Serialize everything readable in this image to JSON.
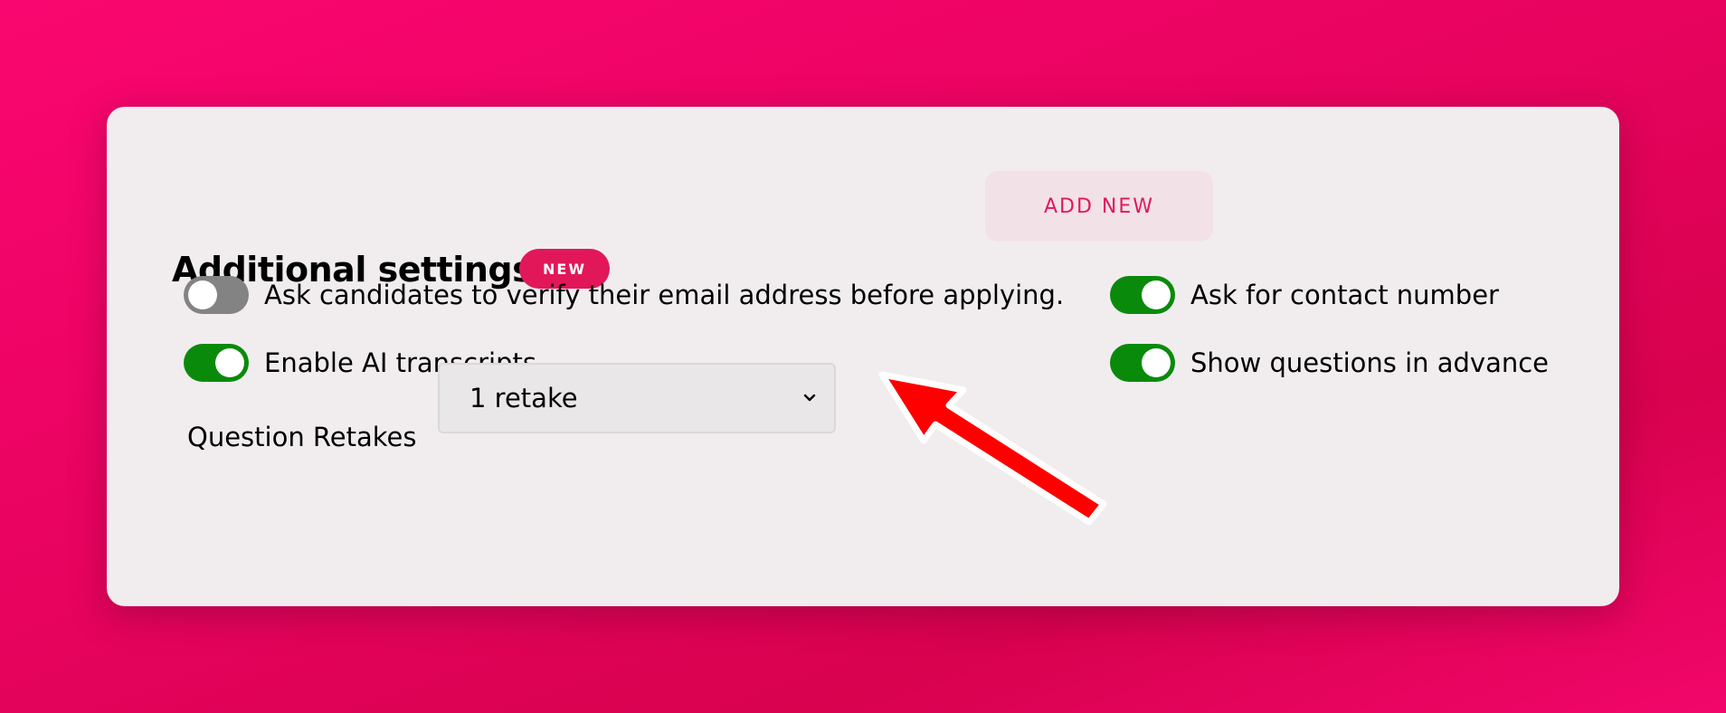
{
  "add_new": {
    "label": "ADD NEW"
  },
  "section": {
    "title": "Additional settings",
    "badge": "NEW"
  },
  "settings": [
    {
      "label": "Ask candidates to verify their email address before applying.",
      "enabled": false
    },
    {
      "label": "Ask for contact number",
      "enabled": true
    },
    {
      "label": "Enable AI transcripts",
      "enabled": true
    },
    {
      "label": "Show questions in advance",
      "enabled": true
    }
  ],
  "retakes": {
    "label": "Question Retakes",
    "selected": "1 retake"
  },
  "colors": {
    "accent": "#e2175a",
    "toggle_on": "#0a8a0a",
    "toggle_off": "#838383",
    "annotation_arrow": "#ff0000"
  }
}
